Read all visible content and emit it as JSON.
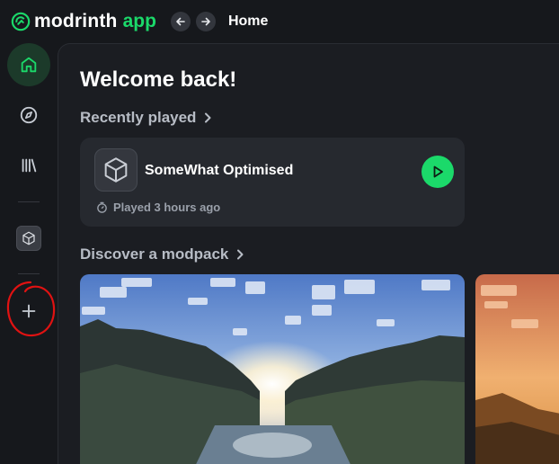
{
  "app": {
    "brand_name": "modrinth",
    "brand_suffix": "app",
    "accent": "#1bd96a"
  },
  "topbar": {
    "back_icon": "arrow-left-icon",
    "forward_icon": "arrow-right-icon",
    "breadcrumb": "Home"
  },
  "sidebar": {
    "items": [
      {
        "name": "home",
        "icon": "home-icon",
        "active": true
      },
      {
        "name": "browse",
        "icon": "compass-icon",
        "active": false
      },
      {
        "name": "library",
        "icon": "library-icon",
        "active": false
      }
    ],
    "instances": [
      {
        "icon": "cube-icon"
      }
    ],
    "add_icon": "plus-icon"
  },
  "main": {
    "welcome": "Welcome back!",
    "recently_played": {
      "title": "Recently played",
      "items": [
        {
          "name": "SomeWhat Optimised",
          "icon": "cube-icon",
          "last_played": "Played 3 hours ago"
        }
      ]
    },
    "discover": {
      "title": "Discover a modpack"
    }
  }
}
